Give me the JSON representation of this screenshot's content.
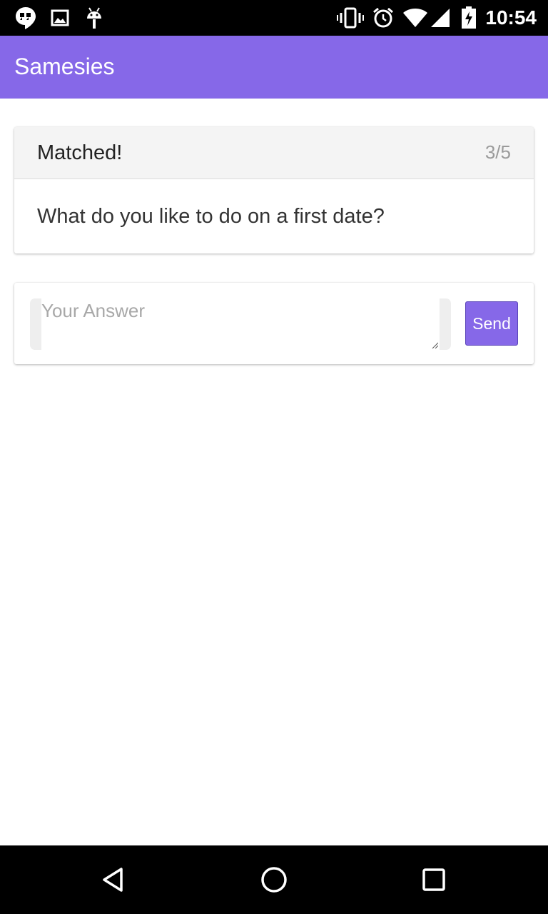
{
  "status_bar": {
    "time": "10:54",
    "left_icons": [
      "hangouts-icon",
      "image-icon",
      "android-icon"
    ],
    "right_icons": [
      "vibrate-icon",
      "alarm-icon",
      "wifi-icon",
      "signal-icon",
      "battery-icon"
    ]
  },
  "app_bar": {
    "title": "Samesies",
    "color": "#8668e8"
  },
  "question_card": {
    "title": "Matched!",
    "count": "3/5",
    "question": "What do you like to do on a first date?"
  },
  "answer_form": {
    "placeholder": "Your Answer",
    "value": "",
    "send_label": "Send"
  },
  "nav_bar": {
    "buttons": [
      "back-icon",
      "home-icon",
      "recents-icon"
    ]
  }
}
